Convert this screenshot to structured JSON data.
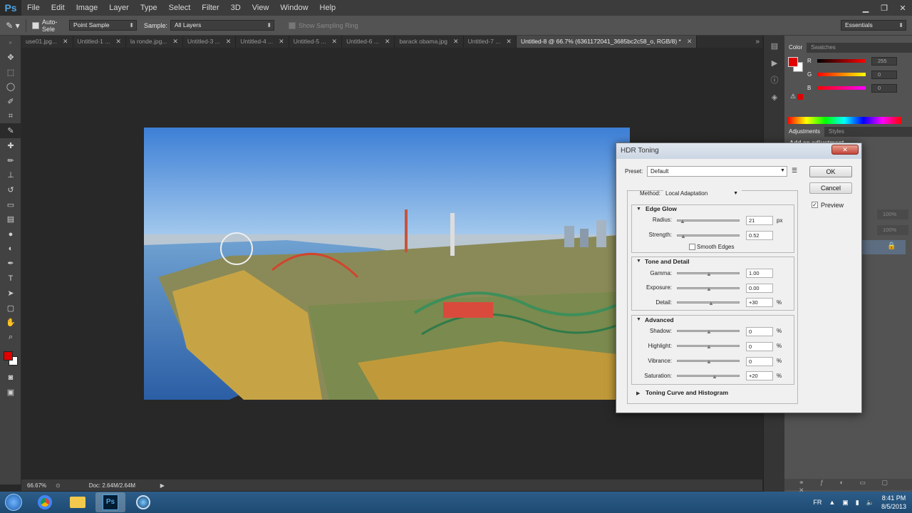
{
  "app": {
    "logo": "Ps",
    "colors": {
      "menubar": "#3c3c3c",
      "panel": "#535353",
      "accent_fg": "#e10000"
    }
  },
  "menu": [
    "File",
    "Edit",
    "Image",
    "Layer",
    "Type",
    "Select",
    "Filter",
    "3D",
    "View",
    "Window",
    "Help"
  ],
  "options": {
    "auto_select": "Auto-Sele",
    "sample_size": "Point Sample",
    "sample_label": "Sample:",
    "sample_value": "All Layers",
    "show_ring": "Show Sampling Ring",
    "workspace": "Essentials"
  },
  "tabs": [
    {
      "label": "use01.jpg..."
    },
    {
      "label": "Untitled-1 ..."
    },
    {
      "label": "la ronde.jpg..."
    },
    {
      "label": "Untitled-3 ..."
    },
    {
      "label": "Untitled-4 ..."
    },
    {
      "label": "Untitled-5 ..."
    },
    {
      "label": "Untitled-6 ..."
    },
    {
      "label": "barack obama.jpg"
    },
    {
      "label": "Untitled-7 ..."
    },
    {
      "label": "Untitled-8 @ 66.7% (6361172041_3685bc2c58_o, RGB/8) *"
    }
  ],
  "status": {
    "zoom": "66.67%",
    "doc": "Doc: 2.64M/2.64M"
  },
  "color_panel": {
    "tabs": [
      "Color",
      "Swatches"
    ],
    "channels": [
      {
        "label": "R",
        "value": "255"
      },
      {
        "label": "G",
        "value": "0"
      },
      {
        "label": "B",
        "value": "0"
      }
    ]
  },
  "adjust_panel": {
    "tabs": [
      "Adjustments",
      "Styles"
    ],
    "hint": "Add an adjustment"
  },
  "layers_panel": {
    "opacity": "100%",
    "fill": "100%"
  },
  "dialog": {
    "title": "HDR Toning",
    "preset_label": "Preset:",
    "preset_value": "Default",
    "ok": "OK",
    "cancel": "Cancel",
    "preview_label": "Preview",
    "method_label": "Method:",
    "method_value": "Local Adaptation",
    "edge_glow": {
      "title": "Edge Glow",
      "radius_label": "Radius:",
      "radius": "21",
      "radius_unit": "px",
      "strength_label": "Strength:",
      "strength": "0.52",
      "smooth_label": "Smooth Edges"
    },
    "tone": {
      "title": "Tone and Detail",
      "gamma_label": "Gamma:",
      "gamma": "1.00",
      "exposure_label": "Exposure:",
      "exposure": "0.00",
      "detail_label": "Detail:",
      "detail": "+30",
      "detail_unit": "%"
    },
    "advanced": {
      "title": "Advanced",
      "shadow_label": "Shadow:",
      "shadow": "0",
      "highlight_label": "Highlight:",
      "highlight": "0",
      "vibrance_label": "Vibrance:",
      "vibrance": "0",
      "saturation_label": "Saturation:",
      "saturation": "+20",
      "unit": "%"
    },
    "toning_curve": "Toning Curve and Histogram"
  },
  "taskbar": {
    "lang": "FR",
    "time": "8:41 PM",
    "date": "8/5/2013"
  }
}
